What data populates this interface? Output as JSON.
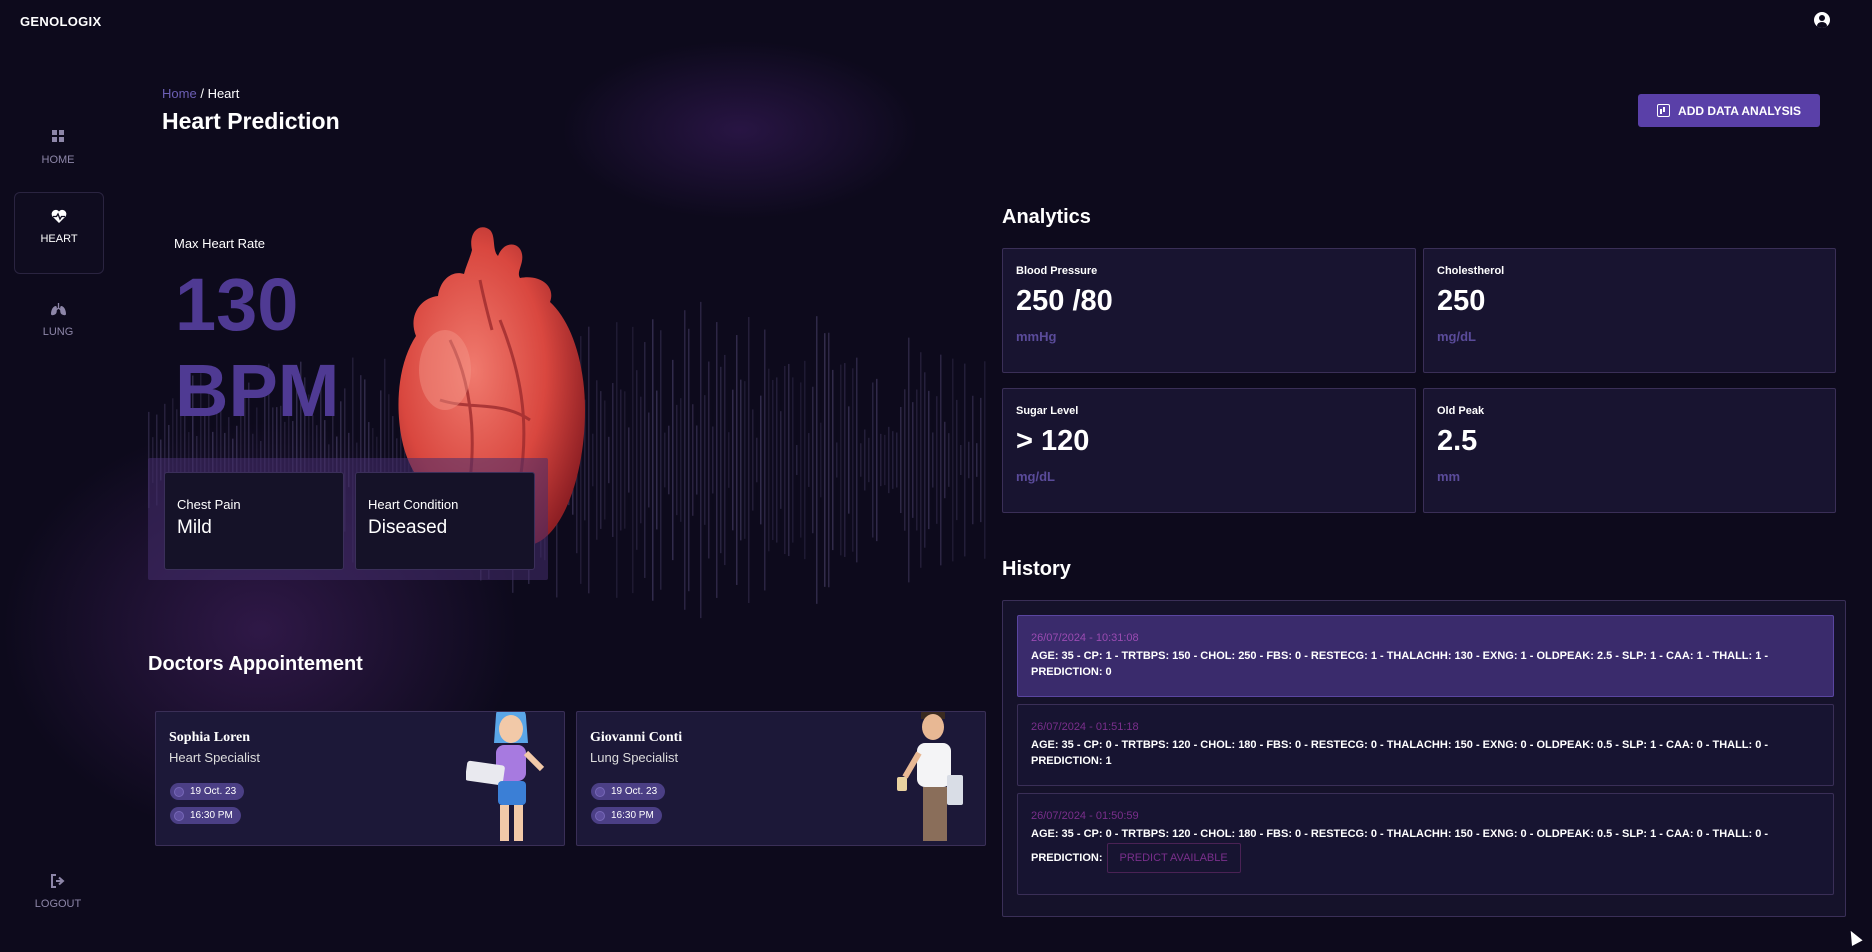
{
  "app": {
    "logo": "GENOLOGIX"
  },
  "sidebar": {
    "items": [
      {
        "label": "HOME",
        "icon": "grid-icon"
      },
      {
        "label": "HEART",
        "icon": "heart-pulse-icon"
      },
      {
        "label": "LUNG",
        "icon": "lungs-icon"
      }
    ],
    "logout": "LOGOUT"
  },
  "breadcrumb": {
    "home": "Home",
    "separator": "/",
    "current": "Heart"
  },
  "page": {
    "title": "Heart Prediction"
  },
  "actions": {
    "add_label": "ADD DATA ANALYSIS"
  },
  "vitals": {
    "max_heart_rate_label": "Max Heart Rate",
    "max_heart_rate_value": "130",
    "max_heart_rate_unit": "BPM",
    "chest_pain_label": "Chest Pain",
    "chest_pain_value": "Mild",
    "heart_condition_label": "Heart Condition",
    "heart_condition_value": "Diseased"
  },
  "analytics": {
    "title": "Analytics",
    "cards": [
      {
        "label": "Blood Pressure",
        "value": "250 /80",
        "unit": "mmHg"
      },
      {
        "label": "Cholestherol",
        "value": "250",
        "unit": "mg/dL"
      },
      {
        "label": "Sugar Level",
        "value": "> 120",
        "unit": "mg/dL"
      },
      {
        "label": "Old Peak",
        "value": "2.5",
        "unit": "mm"
      }
    ]
  },
  "history": {
    "title": "History",
    "items": [
      {
        "date": "26/07/2024 - 10:31:08",
        "text": "AGE: 35 - CP: 1 - TRTBPS: 150 - CHOL: 250 - FBS: 0 - RESTECG: 1 - THALACHH: 130 - EXNG: 1 - OLDPEAK: 2.5 - SLP: 1 - CAA: 1 - THALL: 1 - PREDICTION: 0"
      },
      {
        "date": "26/07/2024 - 01:51:18",
        "text": "AGE: 35 - CP: 0 - TRTBPS: 120 - CHOL: 180 - FBS: 0 - RESTECG: 0 - THALACHH: 150 - EXNG: 0 - OLDPEAK: 0.5 - SLP: 1 - CAA: 0 - THALL: 0 - PREDICTION: 1"
      },
      {
        "date": "26/07/2024 - 01:50:59",
        "text": "AGE: 35 - CP: 0 - TRTBPS: 120 - CHOL: 180 - FBS: 0 - RESTECG: 0 - THALACHH: 150 - EXNG: 0 - OLDPEAK: 0.5 - SLP: 1 - CAA: 0 - THALL: 0 -",
        "text2": "PREDICTION:",
        "button": "PREDICT AVAILABLE"
      }
    ]
  },
  "appointments": {
    "title": "Doctors Appointement",
    "doctors": [
      {
        "name": "Sophia Loren",
        "specialty": "Heart Specialist",
        "date": "19 Oct. 23",
        "time": "16:30 PM"
      },
      {
        "name": "Giovanni Conti",
        "specialty": "Lung Specialist",
        "date": "19 Oct. 23",
        "time": "16:30 PM"
      }
    ]
  },
  "colors": {
    "accent": "#5a40a8",
    "background": "#0d0a1c",
    "card": "#181430",
    "muted_value": "#4f3a93"
  }
}
